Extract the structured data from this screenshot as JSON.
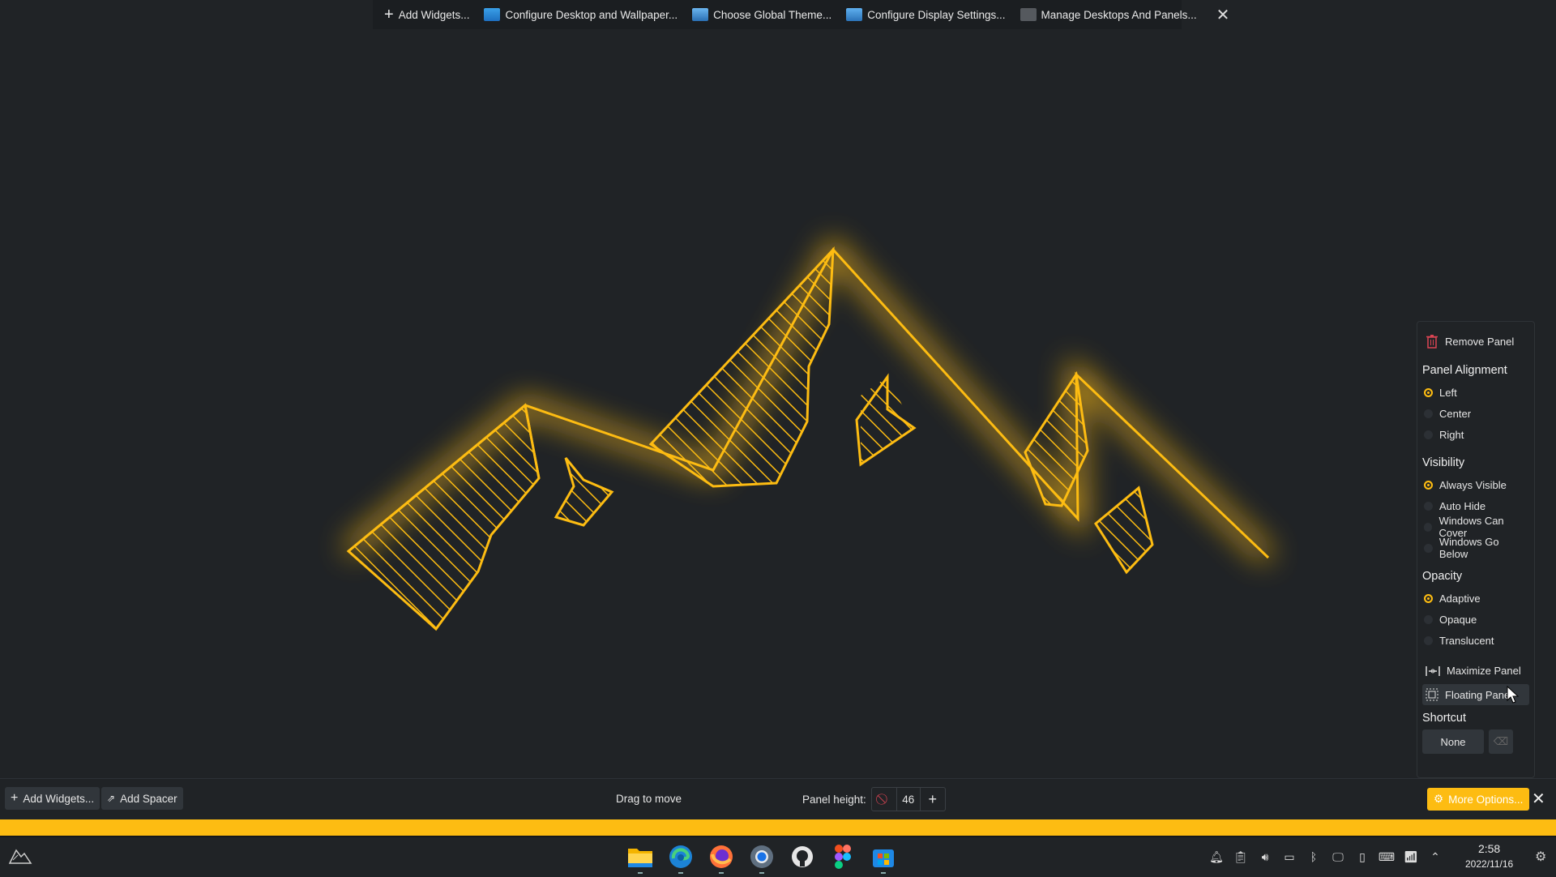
{
  "desktop_toolbar": {
    "add_widgets": "Add Widgets...",
    "configure_desktop": "Configure Desktop and Wallpaper...",
    "global_theme": "Choose Global Theme...",
    "display_settings": "Configure Display Settings...",
    "manage_panels": "Manage Desktops And Panels..."
  },
  "panel_settings": {
    "remove_panel": "Remove Panel",
    "alignment": {
      "title": "Panel Alignment",
      "options": [
        "Left",
        "Center",
        "Right"
      ],
      "selected": "Left"
    },
    "visibility": {
      "title": "Visibility",
      "options": [
        "Always Visible",
        "Auto Hide",
        "Windows Can Cover",
        "Windows Go Below"
      ],
      "selected": "Always Visible"
    },
    "opacity": {
      "title": "Opacity",
      "options": [
        "Adaptive",
        "Opaque",
        "Translucent"
      ],
      "selected": "Adaptive"
    },
    "maximize_panel": "Maximize Panel",
    "floating_panel": "Floating Panel",
    "shortcut": {
      "title": "Shortcut",
      "value": "None"
    }
  },
  "edit_bar": {
    "add_widgets": "Add Widgets...",
    "add_spacer": "Add Spacer",
    "drag_hint": "Drag to move",
    "panel_height_label": "Panel height:",
    "panel_height_value": "46",
    "more_options": "More Options..."
  },
  "taskbar": {
    "apps": [
      "file-manager",
      "edge",
      "firefox",
      "chromium",
      "github",
      "figma",
      "store"
    ],
    "clock": {
      "time": "2:58",
      "date": "2022/11/16"
    }
  },
  "colors": {
    "accent": "#fdbc12",
    "background": "#202326"
  }
}
